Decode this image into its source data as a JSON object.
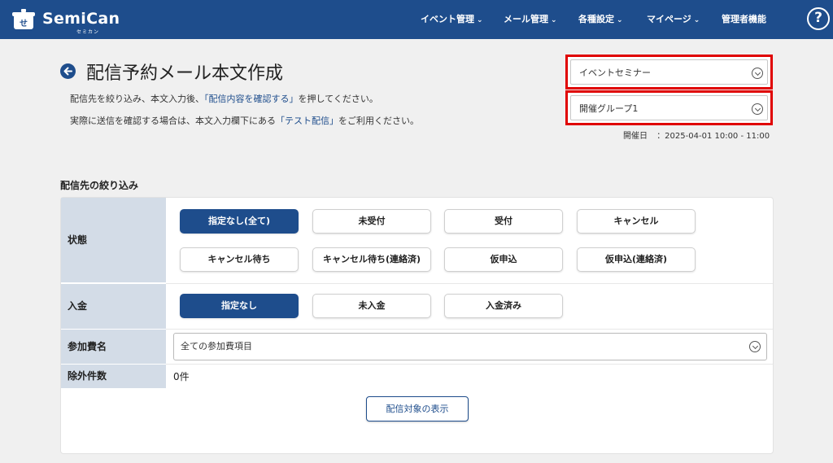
{
  "header": {
    "brand": "SemiCan",
    "brand_sub": "セミカン",
    "nav": [
      {
        "label": "イベント管理",
        "has_menu": true
      },
      {
        "label": "メール管理",
        "has_menu": true
      },
      {
        "label": "各種設定",
        "has_menu": true
      },
      {
        "label": "マイページ",
        "has_menu": true
      },
      {
        "label": "管理者機能",
        "has_menu": false
      }
    ],
    "help_label": "?",
    "chevron": "⌄"
  },
  "page": {
    "title": "配信予約メール本文作成",
    "desc1_a": "配信先を絞り込み、本文入力後、",
    "desc1_b": "「配信内容を確認する」",
    "desc1_c": "を押してください。",
    "desc2_a": "実際に送信を確認する場合は、本文入力欄下にある",
    "desc2_b": "「テスト配信」",
    "desc2_c": "をご利用ください。"
  },
  "selectors": {
    "event": "イベントセミナー",
    "group": "開催グループ1",
    "date_label": "開催日",
    "date_value": "：2025-04-01 10:00 - 11:00"
  },
  "filter": {
    "section_title": "配信先の絞り込み",
    "status_label": "状態",
    "status_options": [
      "指定なし(全て)",
      "未受付",
      "受付",
      "キャンセル",
      "キャンセル待ち",
      "キャンセル待ち(連絡済)",
      "仮申込",
      "仮申込(連絡済)"
    ],
    "status_selected": 0,
    "payment_label": "入金",
    "payment_options": [
      "指定なし",
      "未入金",
      "入金済み"
    ],
    "payment_selected": 0,
    "fee_label": "参加費名",
    "fee_value": "全ての参加費項目",
    "excluded_label": "除外件数",
    "excluded_value": "0件",
    "show_button": "配信対象の表示"
  },
  "colors": {
    "brand": "#1e4d8c",
    "highlight_border": "#e00000",
    "label_bg": "#d3dce7"
  }
}
